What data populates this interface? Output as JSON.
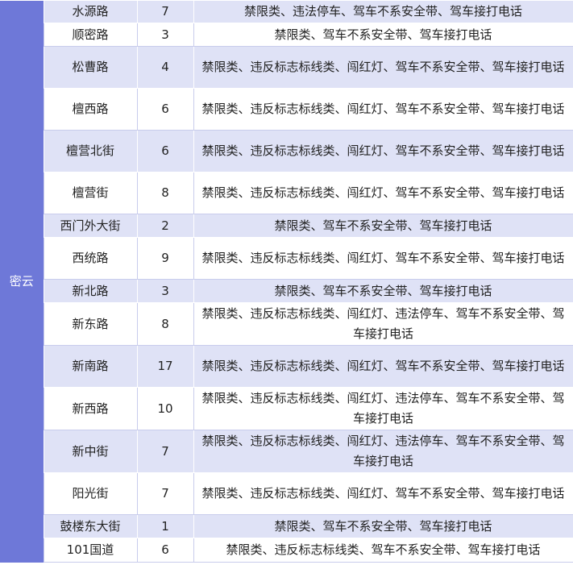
{
  "district": "密云",
  "rows": [
    {
      "road": "水源路",
      "count": "7",
      "violations": "禁限类、违法停车、驾车不系安全带、驾车接打电话"
    },
    {
      "road": "顺密路",
      "count": "3",
      "violations": "禁限类、驾车不系安全带、驾车接打电话"
    },
    {
      "road": "松曹路",
      "count": "4",
      "violations": "禁限类、违反标志标线类、闯红灯、驾车不系安全带、驾车接打电话"
    },
    {
      "road": "檀西路",
      "count": "6",
      "violations": "禁限类、违反标志标线类、闯红灯、驾车不系安全带、驾车接打电话"
    },
    {
      "road": "檀营北街",
      "count": "6",
      "violations": "禁限类、违反标志标线类、闯红灯、驾车不系安全带、驾车接打电话"
    },
    {
      "road": "檀营街",
      "count": "8",
      "violations": "禁限类、违反标志标线类、闯红灯、驾车不系安全带、驾车接打电话"
    },
    {
      "road": "西门外大街",
      "count": "2",
      "violations": "禁限类、驾车不系安全带、驾车接打电话"
    },
    {
      "road": "西统路",
      "count": "9",
      "violations": "禁限类、违反标志标线类、闯红灯、驾车不系安全带、驾车接打电话"
    },
    {
      "road": "新北路",
      "count": "3",
      "violations": "禁限类、驾车不系安全带、驾车接打电话"
    },
    {
      "road": "新东路",
      "count": "8",
      "violations": "禁限类、违反标志标线类、闯红灯、违法停车、驾车不系安全带、驾车接打电话"
    },
    {
      "road": "新南路",
      "count": "17",
      "violations": "禁限类、违反标志标线类、闯红灯、驾车不系安全带、驾车接打电话"
    },
    {
      "road": "新西路",
      "count": "10",
      "violations": "禁限类、违反标志标线类、闯红灯、违法停车、驾车不系安全带、驾车接打电话"
    },
    {
      "road": "新中街",
      "count": "7",
      "violations": "禁限类、违反标志标线类、闯红灯、违法停车、驾车不系安全带、驾车接打电话"
    },
    {
      "road": "阳光街",
      "count": "7",
      "violations": "禁限类、违反标志标线类、闯红灯、驾车不系安全带、驾车接打电话"
    },
    {
      "road": "鼓楼东大街",
      "count": "1",
      "violations": "禁限类、驾车不系安全带、驾车接打电话"
    },
    {
      "road": "101国道",
      "count": "6",
      "violations": "禁限类、违反标志标线类、驾车不系安全带、驾车接打电话"
    }
  ]
}
